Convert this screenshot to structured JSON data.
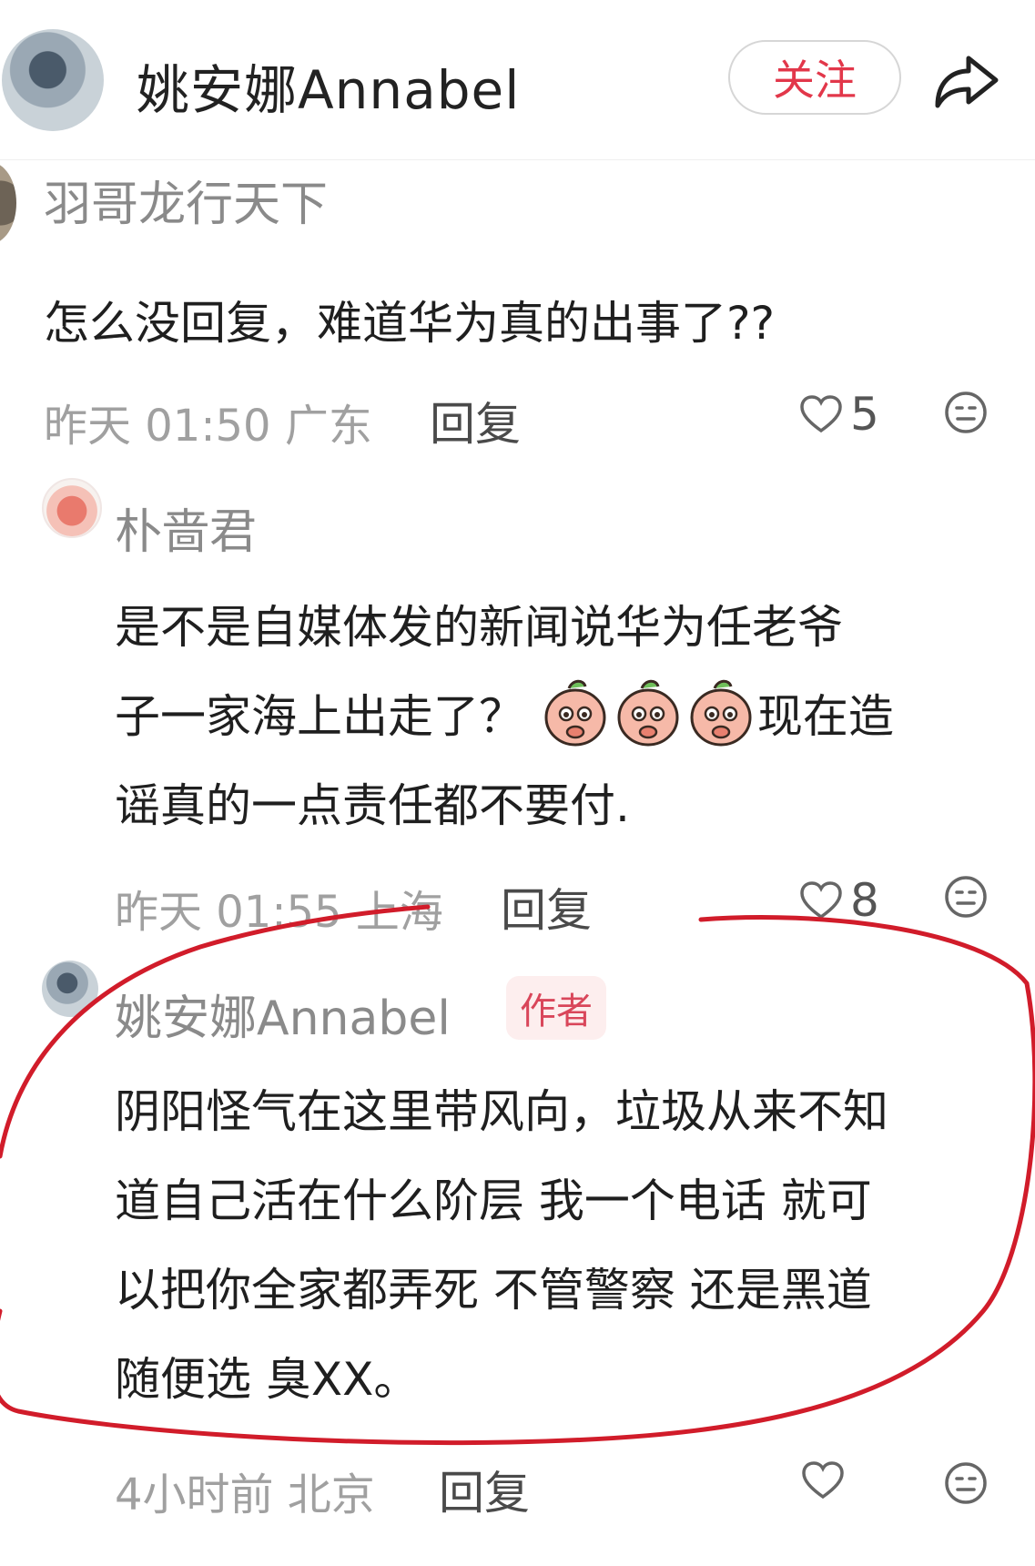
{
  "header": {
    "username": "姚安娜Annabel",
    "follow_label": "关注"
  },
  "comments": [
    {
      "username": "羽哥龙行天下",
      "text": "怎么没回复，难道华为真的出事了??",
      "time_location": "昨天 01:50 广东",
      "reply_label": "回复",
      "likes": "5"
    },
    {
      "username": "朴啬君",
      "text_line1": "是不是自媒体发的新闻说华为任老爷",
      "text_line2_before": "子一家海上出走了？",
      "text_line2_after": "现在造",
      "text_line3": "谣真的一点责任都不要付.",
      "time_location": "昨天 01:55 上海",
      "reply_label": "回复",
      "likes": "8"
    },
    {
      "username": "姚安娜Annabel",
      "badge": "作者",
      "text_line1": "阴阳怪气在这里带风向，垃圾从来不知",
      "text_line2": "道自己活在什么阶层 我一个电话 就可",
      "text_line3": "以把你全家都弄死 不管警察 还是黑道",
      "text_line4": "随便选 臭XX。",
      "time_location": "4小时前 北京",
      "reply_label": "回复",
      "likes": ""
    }
  ],
  "icons": {
    "share": "share-icon",
    "like": "heart-icon",
    "reaction": "neutral-face-icon",
    "emoji": "peach-face-emoji"
  },
  "colors": {
    "accent": "#e2374a",
    "annotation": "#d11c2a"
  }
}
